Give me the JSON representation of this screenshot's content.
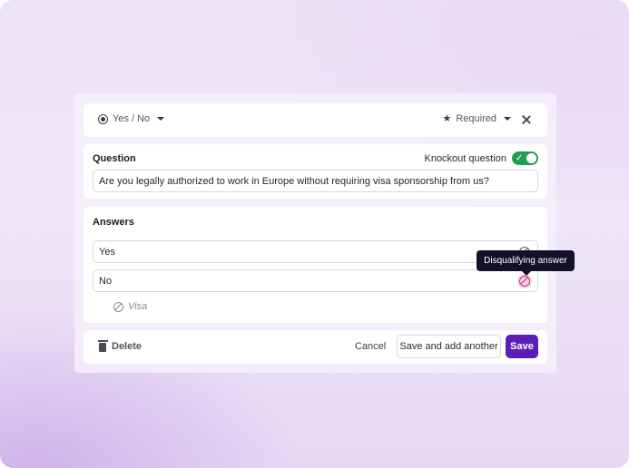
{
  "header": {
    "type_label": "Yes / No",
    "type_icon": "radio-icon",
    "required_label": "Required",
    "required_icon": "star-icon"
  },
  "question": {
    "label": "Question",
    "knockout_label": "Knockout question",
    "knockout_enabled": true,
    "text": "Are you legally authorized to work in Europe without requiring visa sponsorship from us?"
  },
  "answers": {
    "label": "Answers",
    "items": [
      {
        "value": "Yes",
        "disqualifying": false
      },
      {
        "value": "No",
        "disqualifying": true
      }
    ],
    "tag": "Visa"
  },
  "tooltip": {
    "text": "Disqualifying answer"
  },
  "footer": {
    "delete_label": "Delete",
    "cancel_label": "Cancel",
    "save_another_label": "Save and add another",
    "save_label": "Save"
  },
  "colors": {
    "accent": "#5b1fb5",
    "toggle_on": "#1f9d55",
    "disqualify": "#c0327a",
    "tooltip_bg": "#15102a"
  }
}
